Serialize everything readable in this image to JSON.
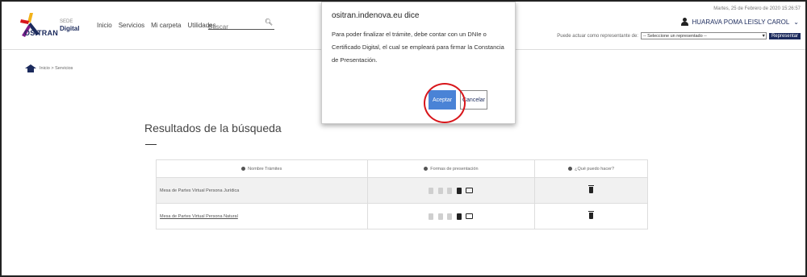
{
  "header": {
    "logo_text": "OSITRAN",
    "logo_sede": "SEDE",
    "logo_digital": "Digital",
    "nav": [
      "Inicio",
      "Servicios",
      "Mi carpeta",
      "Utilidades"
    ],
    "search_placeholder": "Buscar",
    "date": "Martes, 25 de Febrero de 2020 15:26:57",
    "user_name": "HUARAVA POMA LEISLY CAROL",
    "rep_label": "Puede actuar como representante de:",
    "rep_select": "-- Seleccione un representado --",
    "rep_button": "Representar"
  },
  "breadcrumb": "Inicio > Servicios",
  "results": {
    "title": "Resultados de la búsqueda",
    "headers": [
      "Nombre Trámites",
      "Formas de presentación",
      "¿Qué puedo hacer?"
    ],
    "rows": [
      {
        "name": "Mesa de Partes Virtual Persona Jurídica",
        "link": false
      },
      {
        "name": "Mesa de Partes Virtual Persona Natural",
        "link": true
      }
    ]
  },
  "dialog": {
    "title": "ositran.indenova.eu dice",
    "message": "Para poder finalizar el trámite, debe contar con un DNIe o Certificado Digital, el cual se empleará para firmar la Constancia de Presentación.",
    "ok_label": "Aceptar",
    "cancel_label": "Cancelar"
  },
  "colors": {
    "brand": "#1b2a5c",
    "ok_button": "#4a83d6",
    "highlight": "#d8161b"
  }
}
